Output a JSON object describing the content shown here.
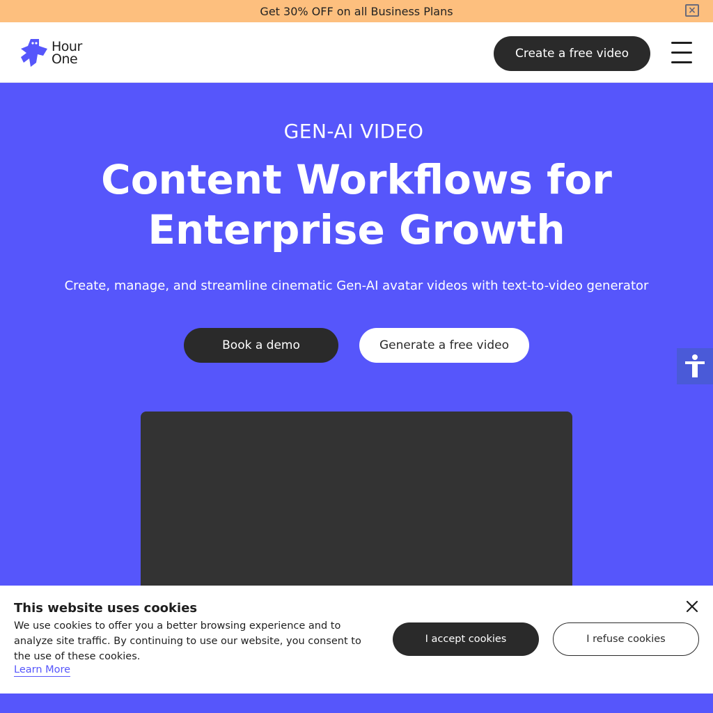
{
  "promo": {
    "text": "Get 30% OFF on all Business Plans",
    "close_icon": "close-icon"
  },
  "header": {
    "logo": {
      "line1": "Hour",
      "line2": "One",
      "mark_color": "#5656fb"
    },
    "cta_label": "Create a free video",
    "menu_icon": "hamburger-menu-icon"
  },
  "hero": {
    "eyebrow": "GEN-AI VIDEO",
    "headline_line1": "Content Workflows for",
    "headline_line2": "Enterprise Growth",
    "subhead": "Create, manage, and streamline cinematic Gen-AI avatar videos with text-to-video generator",
    "primary_button": "Book a demo",
    "secondary_button": "Generate a free video",
    "background_color": "#5656fb"
  },
  "accessibility": {
    "icon": "accessibility-icon",
    "color": "#4a5ad8"
  },
  "cookie_banner": {
    "title": "This website uses cookies",
    "body": "We use cookies to offer you a better browsing experience and to analyze site traffic. By continuing to use our website, you consent to the use of these cookies.",
    "learn_more": "Learn More",
    "accept_label": "I accept cookies",
    "refuse_label": "I refuse cookies",
    "close_icon": "close-icon"
  }
}
